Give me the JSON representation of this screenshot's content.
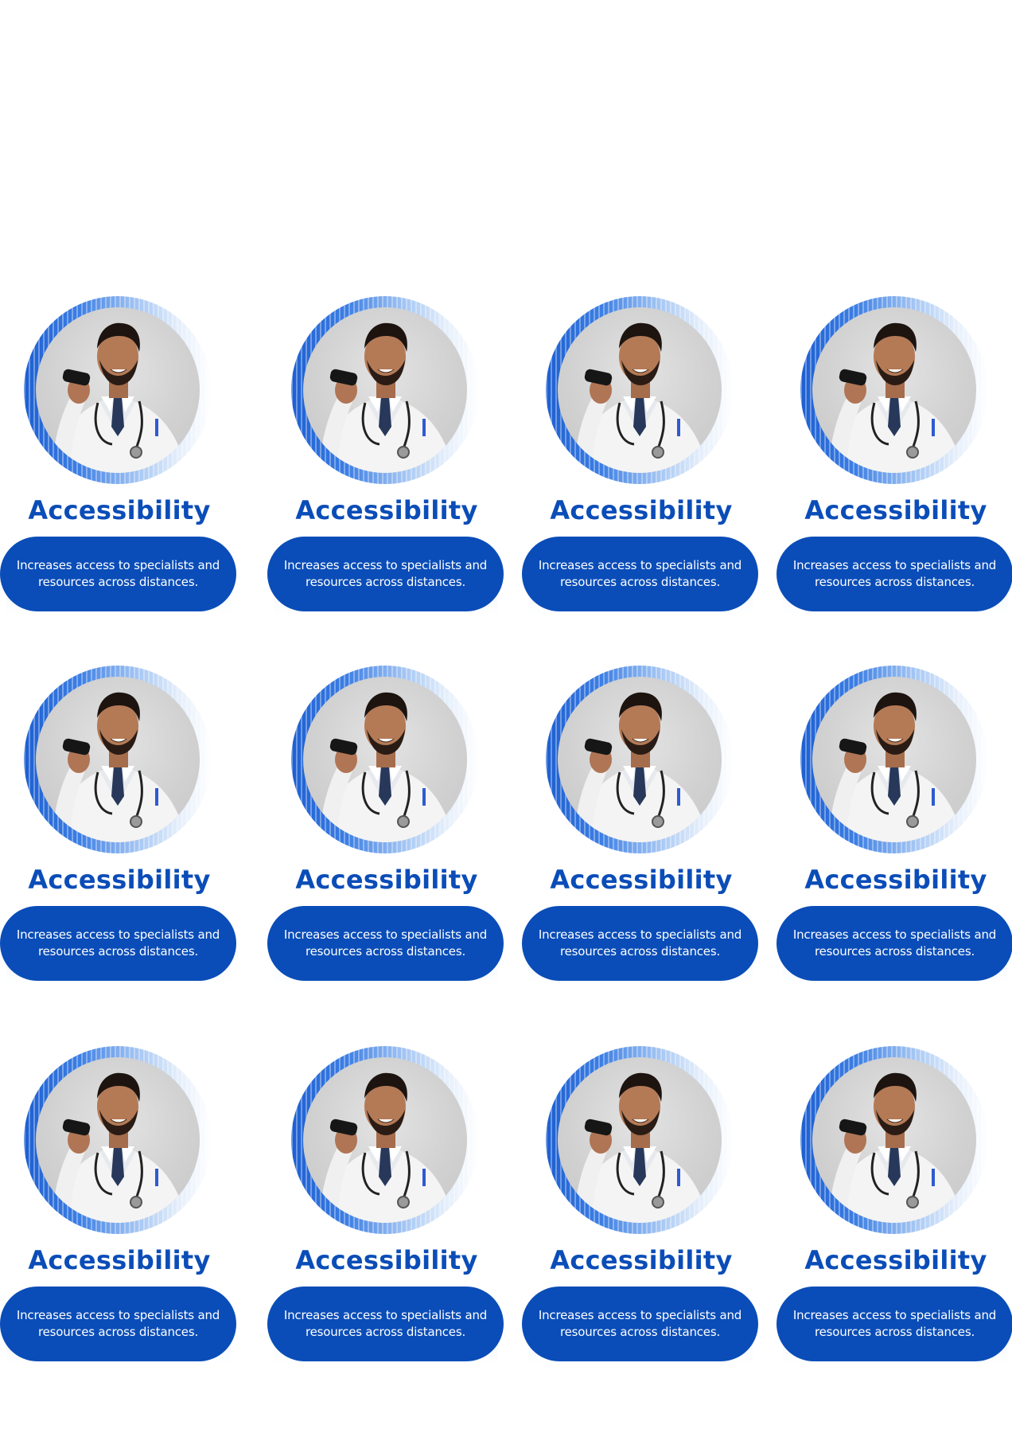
{
  "cards": [
    {
      "title": "Accessibility",
      "description": "Increases access to specialists and resources across distances."
    },
    {
      "title": "Accessibility",
      "description": "Increases access to specialists and resources across distances."
    },
    {
      "title": "Accessibility",
      "description": "Increases access to specialists and resources across distances."
    },
    {
      "title": "Accessibility",
      "description": "Increases access to specialists and resources across distances."
    },
    {
      "title": "Accessibility",
      "description": "Increases access to specialists and resources across distances."
    },
    {
      "title": "Accessibility",
      "description": "Increases access to specialists and resources across distances."
    },
    {
      "title": "Accessibility",
      "description": "Increases access to specialists and resources across distances."
    },
    {
      "title": "Accessibility",
      "description": "Increases access to specialists and resources across distances."
    },
    {
      "title": "Accessibility",
      "description": "Increases access to specialists and resources across distances."
    },
    {
      "title": "Accessibility",
      "description": "Increases access to specialists and resources across distances."
    },
    {
      "title": "Accessibility",
      "description": "Increases access to specialists and resources across distances."
    },
    {
      "title": "Accessibility",
      "description": "Increases access to specialists and resources across distances."
    }
  ],
  "image_subject": "doctor-talking-on-phone",
  "colors": {
    "brand_blue": "#0a4db8",
    "title_blue": "#0b4db8",
    "ring_blue": "#1d5fd1",
    "text_on_pill": "#ffffff"
  }
}
